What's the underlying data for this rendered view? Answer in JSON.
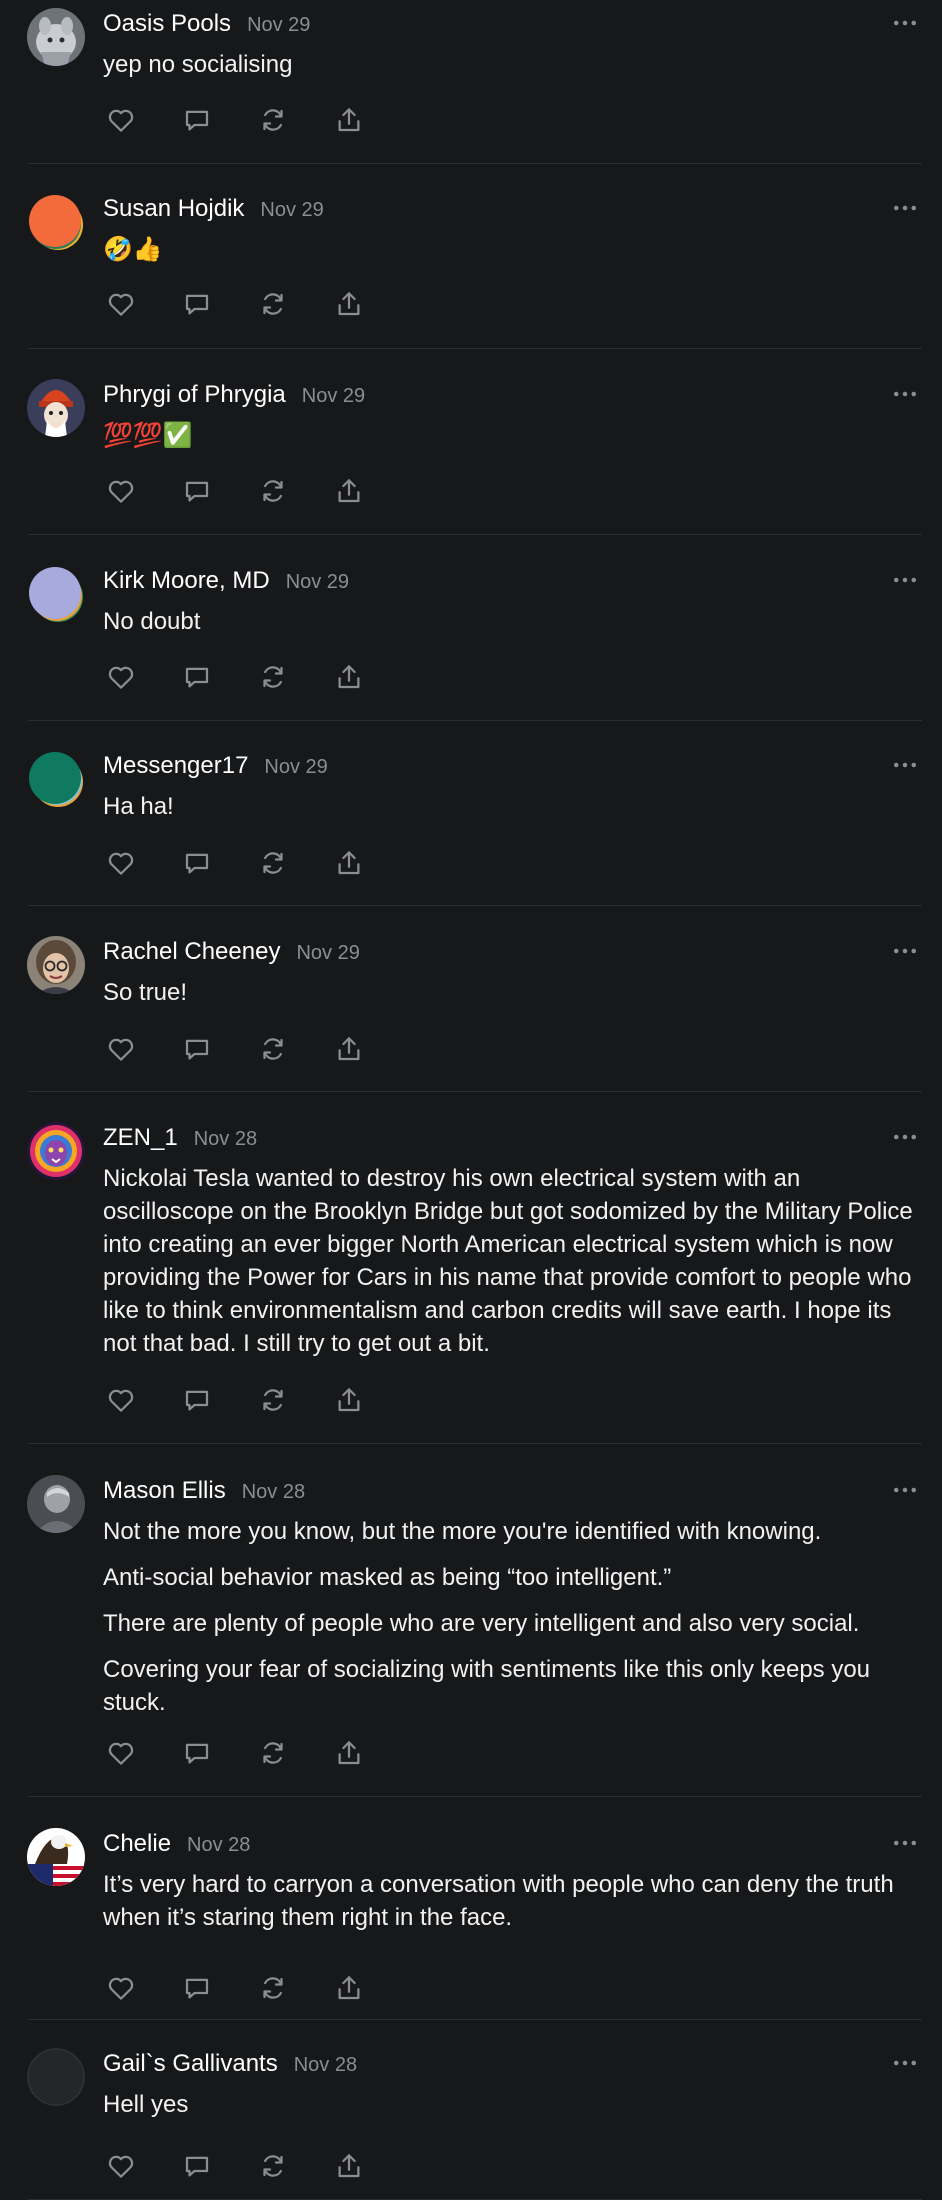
{
  "comments": [
    {
      "author": "Oasis Pools",
      "date": "Nov 29",
      "paragraphs": [
        "yep no socialising"
      ],
      "avatar": "gray-animal-avatar"
    },
    {
      "author": "Susan Hojdik",
      "date": "Nov 29",
      "paragraphs": [
        "🤣👍"
      ],
      "avatar": "orange-blob-avatar"
    },
    {
      "author": "Phrygi of Phrygia",
      "date": "Nov 29",
      "paragraphs": [
        "💯💯✅"
      ],
      "avatar": "red-hat-person-avatar"
    },
    {
      "author": "Kirk Moore, MD",
      "date": "Nov 29",
      "paragraphs": [
        "No doubt"
      ],
      "avatar": "lavender-blob-avatar"
    },
    {
      "author": "Messenger17",
      "date": "Nov 29",
      "paragraphs": [
        "Ha ha!"
      ],
      "avatar": "teal-blob-avatar"
    },
    {
      "author": "Rachel Cheeney",
      "date": "Nov 29",
      "paragraphs": [
        "So true!"
      ],
      "avatar": "woman-glasses-avatar"
    },
    {
      "author": "ZEN_1",
      "date": "Nov 28",
      "paragraphs": [
        "Nickolai Tesla wanted to destroy his own electrical system with an oscilloscope on the Brooklyn Bridge but got sodomized by the Military Police into creating an ever bigger North American electrical system which is now providing the Power for Cars in his name that provide comfort to people who like to think environmentalism and carbon credits will save earth. I hope its not that bad. I still try to get out a bit."
      ],
      "avatar": "colorful-lion-avatar"
    },
    {
      "author": "Mason Ellis",
      "date": "Nov 28",
      "paragraphs": [
        "Not the more you know, but the more you're identified with knowing.",
        "Anti-social behavior masked as being “too intelligent.”",
        "There are plenty of people who are very intelligent and also very social.",
        "Covering your fear of socializing with sentiments like this only keeps you stuck."
      ],
      "avatar": "gray-portrait-avatar"
    },
    {
      "author": "Chelie",
      "date": "Nov 28",
      "paragraphs": [
        "It’s very hard to carryon a conversation with people who can deny the truth when it’s staring them right in the face."
      ],
      "avatar": "eagle-flag-avatar"
    },
    {
      "author": "Gail`s Gallivants",
      "date": "Nov 28",
      "paragraphs": [
        "Hell yes"
      ],
      "avatar": "dark-avatar"
    }
  ],
  "icons": {
    "like": "heart-icon",
    "reply": "comment-icon",
    "restack": "restack-icon",
    "share": "share-icon",
    "more": "more-icon"
  },
  "colors": {
    "background": "#17181a",
    "text": "#ffffff",
    "muted": "#8b8d91",
    "divider": "#2c2d30"
  }
}
